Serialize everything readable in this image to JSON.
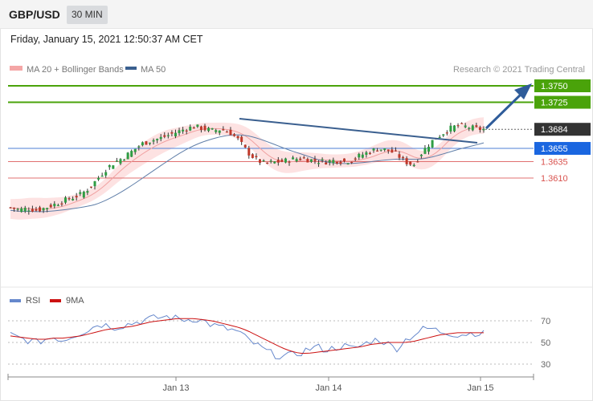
{
  "header": {
    "symbol": "GBP/USD",
    "timeframe": "30 MIN",
    "datetime": "Friday, January 15, 2021 12:50:37 AM CET"
  },
  "legend": {
    "ma20": "MA 20 + Bollinger Bands",
    "ma50": "MA 50",
    "ma20_color": "#f08080",
    "ma50_color": "#3a5f8f",
    "credit": "Research © 2021 Trading Central"
  },
  "rsi_legend": {
    "rsi": "RSI",
    "ma9": "9MA",
    "rsi_color": "#6688cc",
    "ma9_color": "#cc1111"
  },
  "chart_data": [
    {
      "type": "candlestick",
      "x_tick_labels": [
        "Jan 13",
        "Jan 14",
        "Jan 15"
      ],
      "levels": [
        {
          "value": 1.375,
          "label": "1.3750",
          "kind": "target",
          "color": "#4aa30a"
        },
        {
          "value": 1.3725,
          "label": "1.3725",
          "kind": "target",
          "color": "#4aa30a"
        },
        {
          "value": 1.3684,
          "label": "1.3684",
          "kind": "last-price",
          "color": "#333333"
        },
        {
          "value": 1.3655,
          "label": "1.3655",
          "kind": "pivot",
          "color": "#1a66e0"
        },
        {
          "value": 1.3635,
          "label": "1.3635",
          "kind": "support",
          "color": "#d9534f"
        },
        {
          "value": 1.361,
          "label": "1.3610",
          "kind": "support",
          "color": "#d9534f"
        }
      ],
      "close_path": [
        1.3565,
        1.3562,
        1.3564,
        1.3561,
        1.3565,
        1.357,
        1.3575,
        1.358,
        1.3585,
        1.3595,
        1.361,
        1.3625,
        1.3635,
        1.3642,
        1.3652,
        1.3662,
        1.3667,
        1.367,
        1.3675,
        1.368,
        1.3685,
        1.3688,
        1.3685,
        1.3682,
        1.3684,
        1.368,
        1.3668,
        1.365,
        1.3638,
        1.3632,
        1.3634,
        1.3635,
        1.3638,
        1.364,
        1.3638,
        1.3636,
        1.3635,
        1.3637,
        1.3635,
        1.3637,
        1.3645,
        1.365,
        1.3655,
        1.3652,
        1.3647,
        1.3635,
        1.363,
        1.365,
        1.3665,
        1.3675,
        1.3684,
        1.369,
        1.3688,
        1.3685,
        1.3684
      ]
    },
    {
      "type": "line",
      "title": "RSI",
      "y_tick_labels": [
        "70",
        "50",
        "30"
      ],
      "ylim": [
        20,
        80
      ],
      "series": [
        {
          "name": "RSI",
          "values": [
            57,
            54,
            52,
            50,
            53,
            55,
            52,
            56,
            59,
            62,
            67,
            66,
            64,
            66,
            68,
            70,
            72,
            73,
            74,
            72,
            71,
            72,
            70,
            66,
            64,
            62,
            60,
            53,
            48,
            43,
            39,
            37,
            38,
            40,
            44,
            46,
            43,
            45,
            47,
            44,
            47,
            51,
            53,
            49,
            44,
            52,
            57,
            62,
            63,
            60,
            59,
            57,
            58,
            59,
            58
          ]
        },
        {
          "name": "9MA",
          "values": [
            56,
            55,
            54,
            53,
            53,
            54,
            54,
            55,
            56,
            58,
            60,
            62,
            63,
            64,
            65,
            67,
            69,
            70,
            71,
            72,
            72,
            72,
            71,
            70,
            68,
            66,
            64,
            61,
            57,
            53,
            49,
            45,
            42,
            40,
            40,
            41,
            42,
            43,
            44,
            45,
            46,
            48,
            49,
            50,
            50,
            50,
            51,
            53,
            55,
            57,
            58,
            59,
            59,
            59,
            59
          ]
        }
      ]
    }
  ]
}
